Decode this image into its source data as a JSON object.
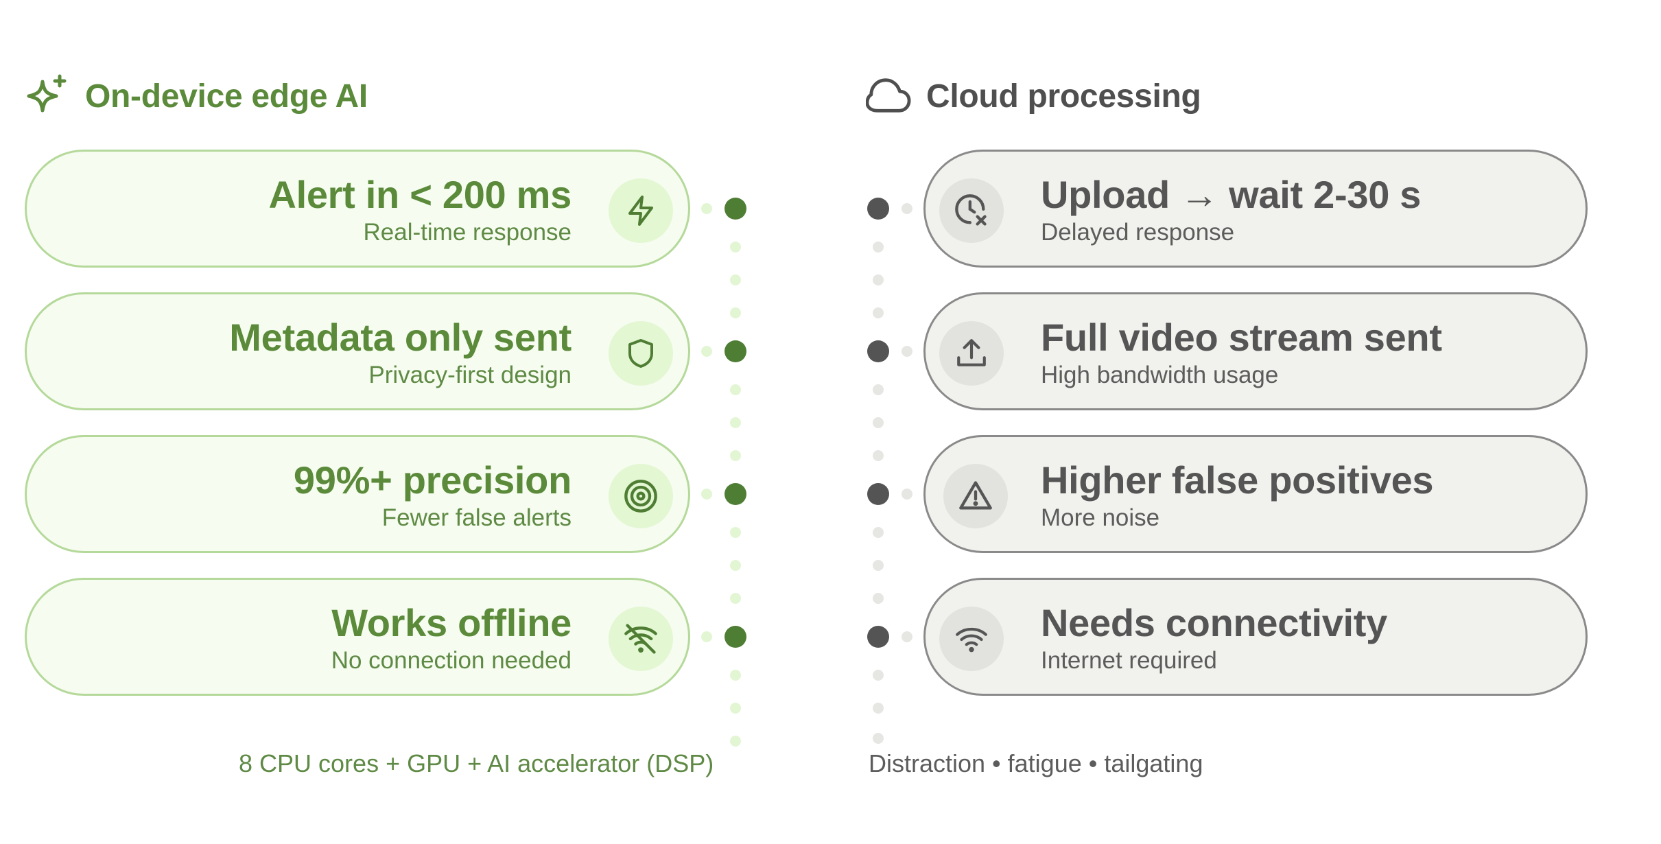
{
  "left": {
    "title": "On-device edge AI",
    "icon": "sparkles-icon",
    "accent": "#5a8a3a",
    "items": [
      {
        "title": "Alert in < 200 ms",
        "subtitle": "Real-time response",
        "icon": "lightning-icon"
      },
      {
        "title": "Metadata only sent",
        "subtitle": "Privacy-first design",
        "icon": "shield-icon"
      },
      {
        "title": "99%+ precision",
        "subtitle": "Fewer false alerts",
        "icon": "target-icon"
      },
      {
        "title": "Works offline",
        "subtitle": "No connection needed",
        "icon": "wifi-off-icon"
      }
    ],
    "footer": "8 CPU cores + GPU + AI accelerator (DSP)"
  },
  "right": {
    "title": "Cloud processing",
    "icon": "cloud-icon",
    "accent": "#555555",
    "items": [
      {
        "title": "Upload → wait 2-30 s",
        "subtitle": "Delayed response",
        "icon": "clock-x-icon"
      },
      {
        "title": "Full video stream sent",
        "subtitle": "High bandwidth usage",
        "icon": "upload-icon"
      },
      {
        "title": "Higher false positives",
        "subtitle": "More noise",
        "icon": "warning-icon"
      },
      {
        "title": "Needs connectivity",
        "subtitle": "Internet required",
        "icon": "wifi-icon"
      }
    ],
    "footer": "Distraction • fatigue • tailgating"
  }
}
